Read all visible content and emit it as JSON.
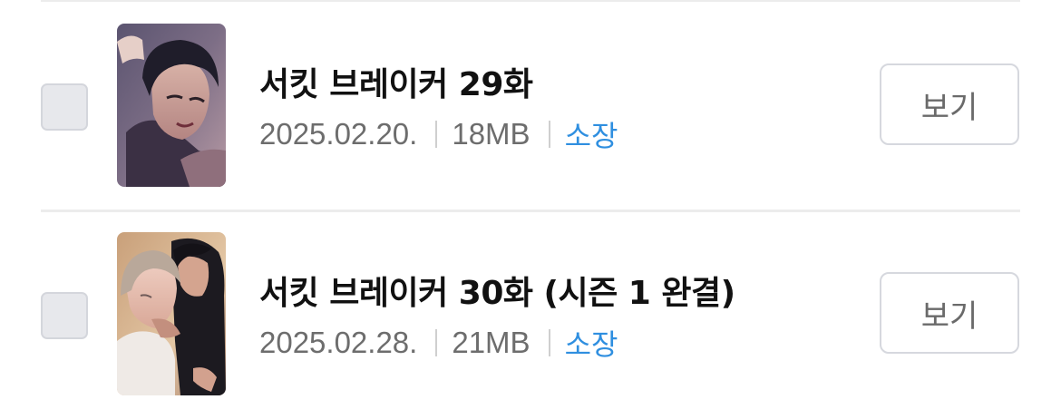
{
  "episodes": [
    {
      "title": "서킷 브레이커 29화",
      "date": "2025.02.20.",
      "size": "18MB",
      "status": "소장",
      "button_label": "보기",
      "thumbnail_icon": "comic-cover-thumbnail"
    },
    {
      "title": "서킷 브레이커 30화 (시즌 1 완결)",
      "date": "2025.02.28.",
      "size": "21MB",
      "status": "소장",
      "button_label": "보기",
      "thumbnail_icon": "comic-cover-thumbnail"
    }
  ],
  "colors": {
    "status_accent": "#2f8fe0",
    "title_text": "#111111",
    "meta_text": "#6d6d6d",
    "checkbox_fill": "#e7e8ec",
    "divider": "#ececec"
  }
}
